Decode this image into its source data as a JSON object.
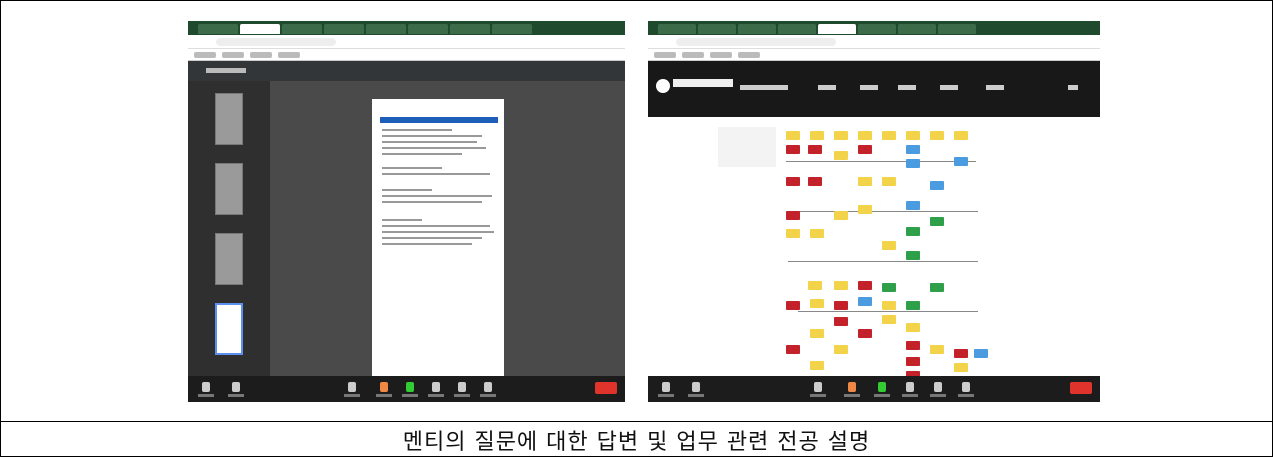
{
  "caption": "멘티의 질문에 대한 답변 및 업무 관련 전공 설명",
  "screens": [
    {
      "name": "pdf-viewer-screenshot",
      "type": "Video call screen share of a PDF document"
    },
    {
      "name": "curriculum-site-screenshot",
      "type": "Video call screen share of a university curriculum roadmap page"
    }
  ],
  "colors": {
    "border": "#000000",
    "meeting_bar": "#1c1c1c",
    "end_button": "#e0332b",
    "roadmap_red": "#c3222a",
    "roadmap_yellow": "#f3d34a",
    "roadmap_blue": "#4a9be0",
    "roadmap_green": "#2fa04a"
  }
}
